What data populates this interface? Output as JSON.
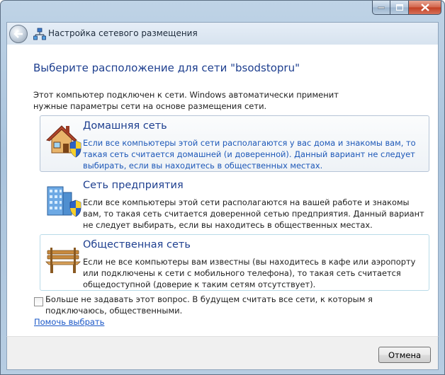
{
  "window": {
    "title": "Настройка сетевого размещения"
  },
  "heading": "Выберите расположение для сети \"bsodstopru\"",
  "intro": "Этот компьютер подключен к сети. Windows автоматически применит нужные параметры сети на основе размещения сети.",
  "options": [
    {
      "title": "Домашняя сеть",
      "description": "Если все компьютеры этой сети располагаются у вас дома и знакомы вам, то такая сеть считается домашней (и доверенной). Данный вариант не следует выбирать, если вы находитесь в общественных местах.",
      "icon": "home-network-icon"
    },
    {
      "title": "Сеть предприятия",
      "description": "Если все компьютеры этой сети располагаются на вашей работе и знакомы вам, то такая сеть считается доверенной сетью предприятия. Данный вариант не следует выбирать, если вы находитесь в общественных местах.",
      "icon": "work-network-icon"
    },
    {
      "title": "Общественная сеть",
      "description": "Если не все компьютеры вам известны (вы находитесь в кафе или аэропорту или подключены к сети с мобильного телефона), то такая сеть считается общедоступной (доверие к таким сетям отсутствует).",
      "icon": "public-network-icon"
    }
  ],
  "checkbox": {
    "label": "Больше не задавать этот вопрос. В будущем считать все сети, к которым я подключаюсь, общественными.",
    "checked": false
  },
  "help_link": "Помочь выбрать",
  "footer": {
    "cancel_label": "Отмена"
  },
  "colors": {
    "heading": "#1e3f8f",
    "link": "#1a57c7",
    "hover_text": "#1d58b8"
  }
}
